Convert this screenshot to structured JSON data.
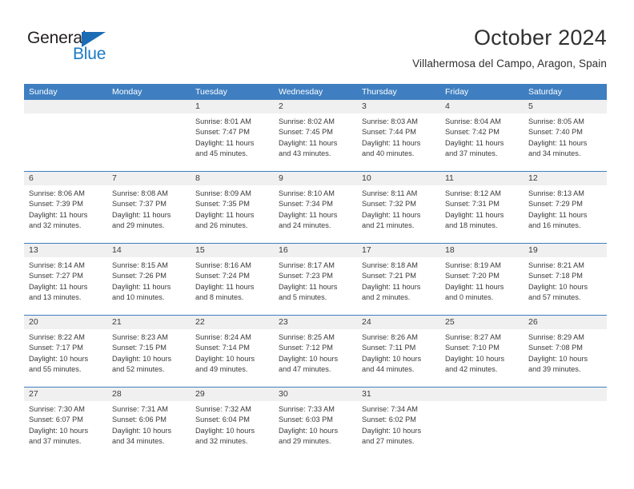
{
  "brand": {
    "name_top": "General",
    "name_bottom": "Blue",
    "accent_color": "#1b7ac4",
    "triangle_color": "#1b6cb5"
  },
  "header": {
    "title": "October 2024",
    "subtitle": "Villahermosa del Campo, Aragon, Spain"
  },
  "calendar": {
    "header_bg": "#3f7fc1",
    "daynum_bg": "#f0f0f0",
    "weekdays": [
      "Sunday",
      "Monday",
      "Tuesday",
      "Wednesday",
      "Thursday",
      "Friday",
      "Saturday"
    ],
    "weeks": [
      [
        {
          "day": "",
          "lines": []
        },
        {
          "day": "",
          "lines": []
        },
        {
          "day": "1",
          "lines": [
            "Sunrise: 8:01 AM",
            "Sunset: 7:47 PM",
            "Daylight: 11 hours",
            "and 45 minutes."
          ]
        },
        {
          "day": "2",
          "lines": [
            "Sunrise: 8:02 AM",
            "Sunset: 7:45 PM",
            "Daylight: 11 hours",
            "and 43 minutes."
          ]
        },
        {
          "day": "3",
          "lines": [
            "Sunrise: 8:03 AM",
            "Sunset: 7:44 PM",
            "Daylight: 11 hours",
            "and 40 minutes."
          ]
        },
        {
          "day": "4",
          "lines": [
            "Sunrise: 8:04 AM",
            "Sunset: 7:42 PM",
            "Daylight: 11 hours",
            "and 37 minutes."
          ]
        },
        {
          "day": "5",
          "lines": [
            "Sunrise: 8:05 AM",
            "Sunset: 7:40 PM",
            "Daylight: 11 hours",
            "and 34 minutes."
          ]
        }
      ],
      [
        {
          "day": "6",
          "lines": [
            "Sunrise: 8:06 AM",
            "Sunset: 7:39 PM",
            "Daylight: 11 hours",
            "and 32 minutes."
          ]
        },
        {
          "day": "7",
          "lines": [
            "Sunrise: 8:08 AM",
            "Sunset: 7:37 PM",
            "Daylight: 11 hours",
            "and 29 minutes."
          ]
        },
        {
          "day": "8",
          "lines": [
            "Sunrise: 8:09 AM",
            "Sunset: 7:35 PM",
            "Daylight: 11 hours",
            "and 26 minutes."
          ]
        },
        {
          "day": "9",
          "lines": [
            "Sunrise: 8:10 AM",
            "Sunset: 7:34 PM",
            "Daylight: 11 hours",
            "and 24 minutes."
          ]
        },
        {
          "day": "10",
          "lines": [
            "Sunrise: 8:11 AM",
            "Sunset: 7:32 PM",
            "Daylight: 11 hours",
            "and 21 minutes."
          ]
        },
        {
          "day": "11",
          "lines": [
            "Sunrise: 8:12 AM",
            "Sunset: 7:31 PM",
            "Daylight: 11 hours",
            "and 18 minutes."
          ]
        },
        {
          "day": "12",
          "lines": [
            "Sunrise: 8:13 AM",
            "Sunset: 7:29 PM",
            "Daylight: 11 hours",
            "and 16 minutes."
          ]
        }
      ],
      [
        {
          "day": "13",
          "lines": [
            "Sunrise: 8:14 AM",
            "Sunset: 7:27 PM",
            "Daylight: 11 hours",
            "and 13 minutes."
          ]
        },
        {
          "day": "14",
          "lines": [
            "Sunrise: 8:15 AM",
            "Sunset: 7:26 PM",
            "Daylight: 11 hours",
            "and 10 minutes."
          ]
        },
        {
          "day": "15",
          "lines": [
            "Sunrise: 8:16 AM",
            "Sunset: 7:24 PM",
            "Daylight: 11 hours",
            "and 8 minutes."
          ]
        },
        {
          "day": "16",
          "lines": [
            "Sunrise: 8:17 AM",
            "Sunset: 7:23 PM",
            "Daylight: 11 hours",
            "and 5 minutes."
          ]
        },
        {
          "day": "17",
          "lines": [
            "Sunrise: 8:18 AM",
            "Sunset: 7:21 PM",
            "Daylight: 11 hours",
            "and 2 minutes."
          ]
        },
        {
          "day": "18",
          "lines": [
            "Sunrise: 8:19 AM",
            "Sunset: 7:20 PM",
            "Daylight: 11 hours",
            "and 0 minutes."
          ]
        },
        {
          "day": "19",
          "lines": [
            "Sunrise: 8:21 AM",
            "Sunset: 7:18 PM",
            "Daylight: 10 hours",
            "and 57 minutes."
          ]
        }
      ],
      [
        {
          "day": "20",
          "lines": [
            "Sunrise: 8:22 AM",
            "Sunset: 7:17 PM",
            "Daylight: 10 hours",
            "and 55 minutes."
          ]
        },
        {
          "day": "21",
          "lines": [
            "Sunrise: 8:23 AM",
            "Sunset: 7:15 PM",
            "Daylight: 10 hours",
            "and 52 minutes."
          ]
        },
        {
          "day": "22",
          "lines": [
            "Sunrise: 8:24 AM",
            "Sunset: 7:14 PM",
            "Daylight: 10 hours",
            "and 49 minutes."
          ]
        },
        {
          "day": "23",
          "lines": [
            "Sunrise: 8:25 AM",
            "Sunset: 7:12 PM",
            "Daylight: 10 hours",
            "and 47 minutes."
          ]
        },
        {
          "day": "24",
          "lines": [
            "Sunrise: 8:26 AM",
            "Sunset: 7:11 PM",
            "Daylight: 10 hours",
            "and 44 minutes."
          ]
        },
        {
          "day": "25",
          "lines": [
            "Sunrise: 8:27 AM",
            "Sunset: 7:10 PM",
            "Daylight: 10 hours",
            "and 42 minutes."
          ]
        },
        {
          "day": "26",
          "lines": [
            "Sunrise: 8:29 AM",
            "Sunset: 7:08 PM",
            "Daylight: 10 hours",
            "and 39 minutes."
          ]
        }
      ],
      [
        {
          "day": "27",
          "lines": [
            "Sunrise: 7:30 AM",
            "Sunset: 6:07 PM",
            "Daylight: 10 hours",
            "and 37 minutes."
          ]
        },
        {
          "day": "28",
          "lines": [
            "Sunrise: 7:31 AM",
            "Sunset: 6:06 PM",
            "Daylight: 10 hours",
            "and 34 minutes."
          ]
        },
        {
          "day": "29",
          "lines": [
            "Sunrise: 7:32 AM",
            "Sunset: 6:04 PM",
            "Daylight: 10 hours",
            "and 32 minutes."
          ]
        },
        {
          "day": "30",
          "lines": [
            "Sunrise: 7:33 AM",
            "Sunset: 6:03 PM",
            "Daylight: 10 hours",
            "and 29 minutes."
          ]
        },
        {
          "day": "31",
          "lines": [
            "Sunrise: 7:34 AM",
            "Sunset: 6:02 PM",
            "Daylight: 10 hours",
            "and 27 minutes."
          ]
        },
        {
          "day": "",
          "lines": []
        },
        {
          "day": "",
          "lines": []
        }
      ]
    ]
  }
}
